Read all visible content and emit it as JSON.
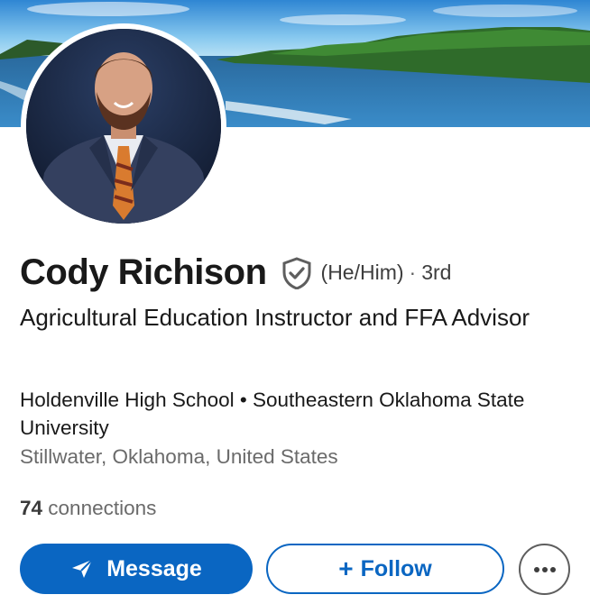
{
  "profile": {
    "name": "Cody Richison",
    "pronouns": "(He/Him)",
    "separator": "·",
    "degree": "3rd",
    "headline": "Agricultural Education Instructor and FFA Advisor",
    "education": "Holdenville High School • Southeastern Oklahoma State University",
    "location": "Stillwater, Oklahoma, United States",
    "connections_count": "74",
    "connections_label": "connections"
  },
  "actions": {
    "message_label": "Message",
    "follow_label": "Follow",
    "follow_prefix": "+"
  },
  "icons": {
    "verified": "shield-check-icon",
    "message": "send-icon",
    "more": "more-horizontal-icon"
  },
  "colors": {
    "brand": "#0a66c2",
    "text_primary": "#191919",
    "text_secondary": "#6a6a6a"
  }
}
